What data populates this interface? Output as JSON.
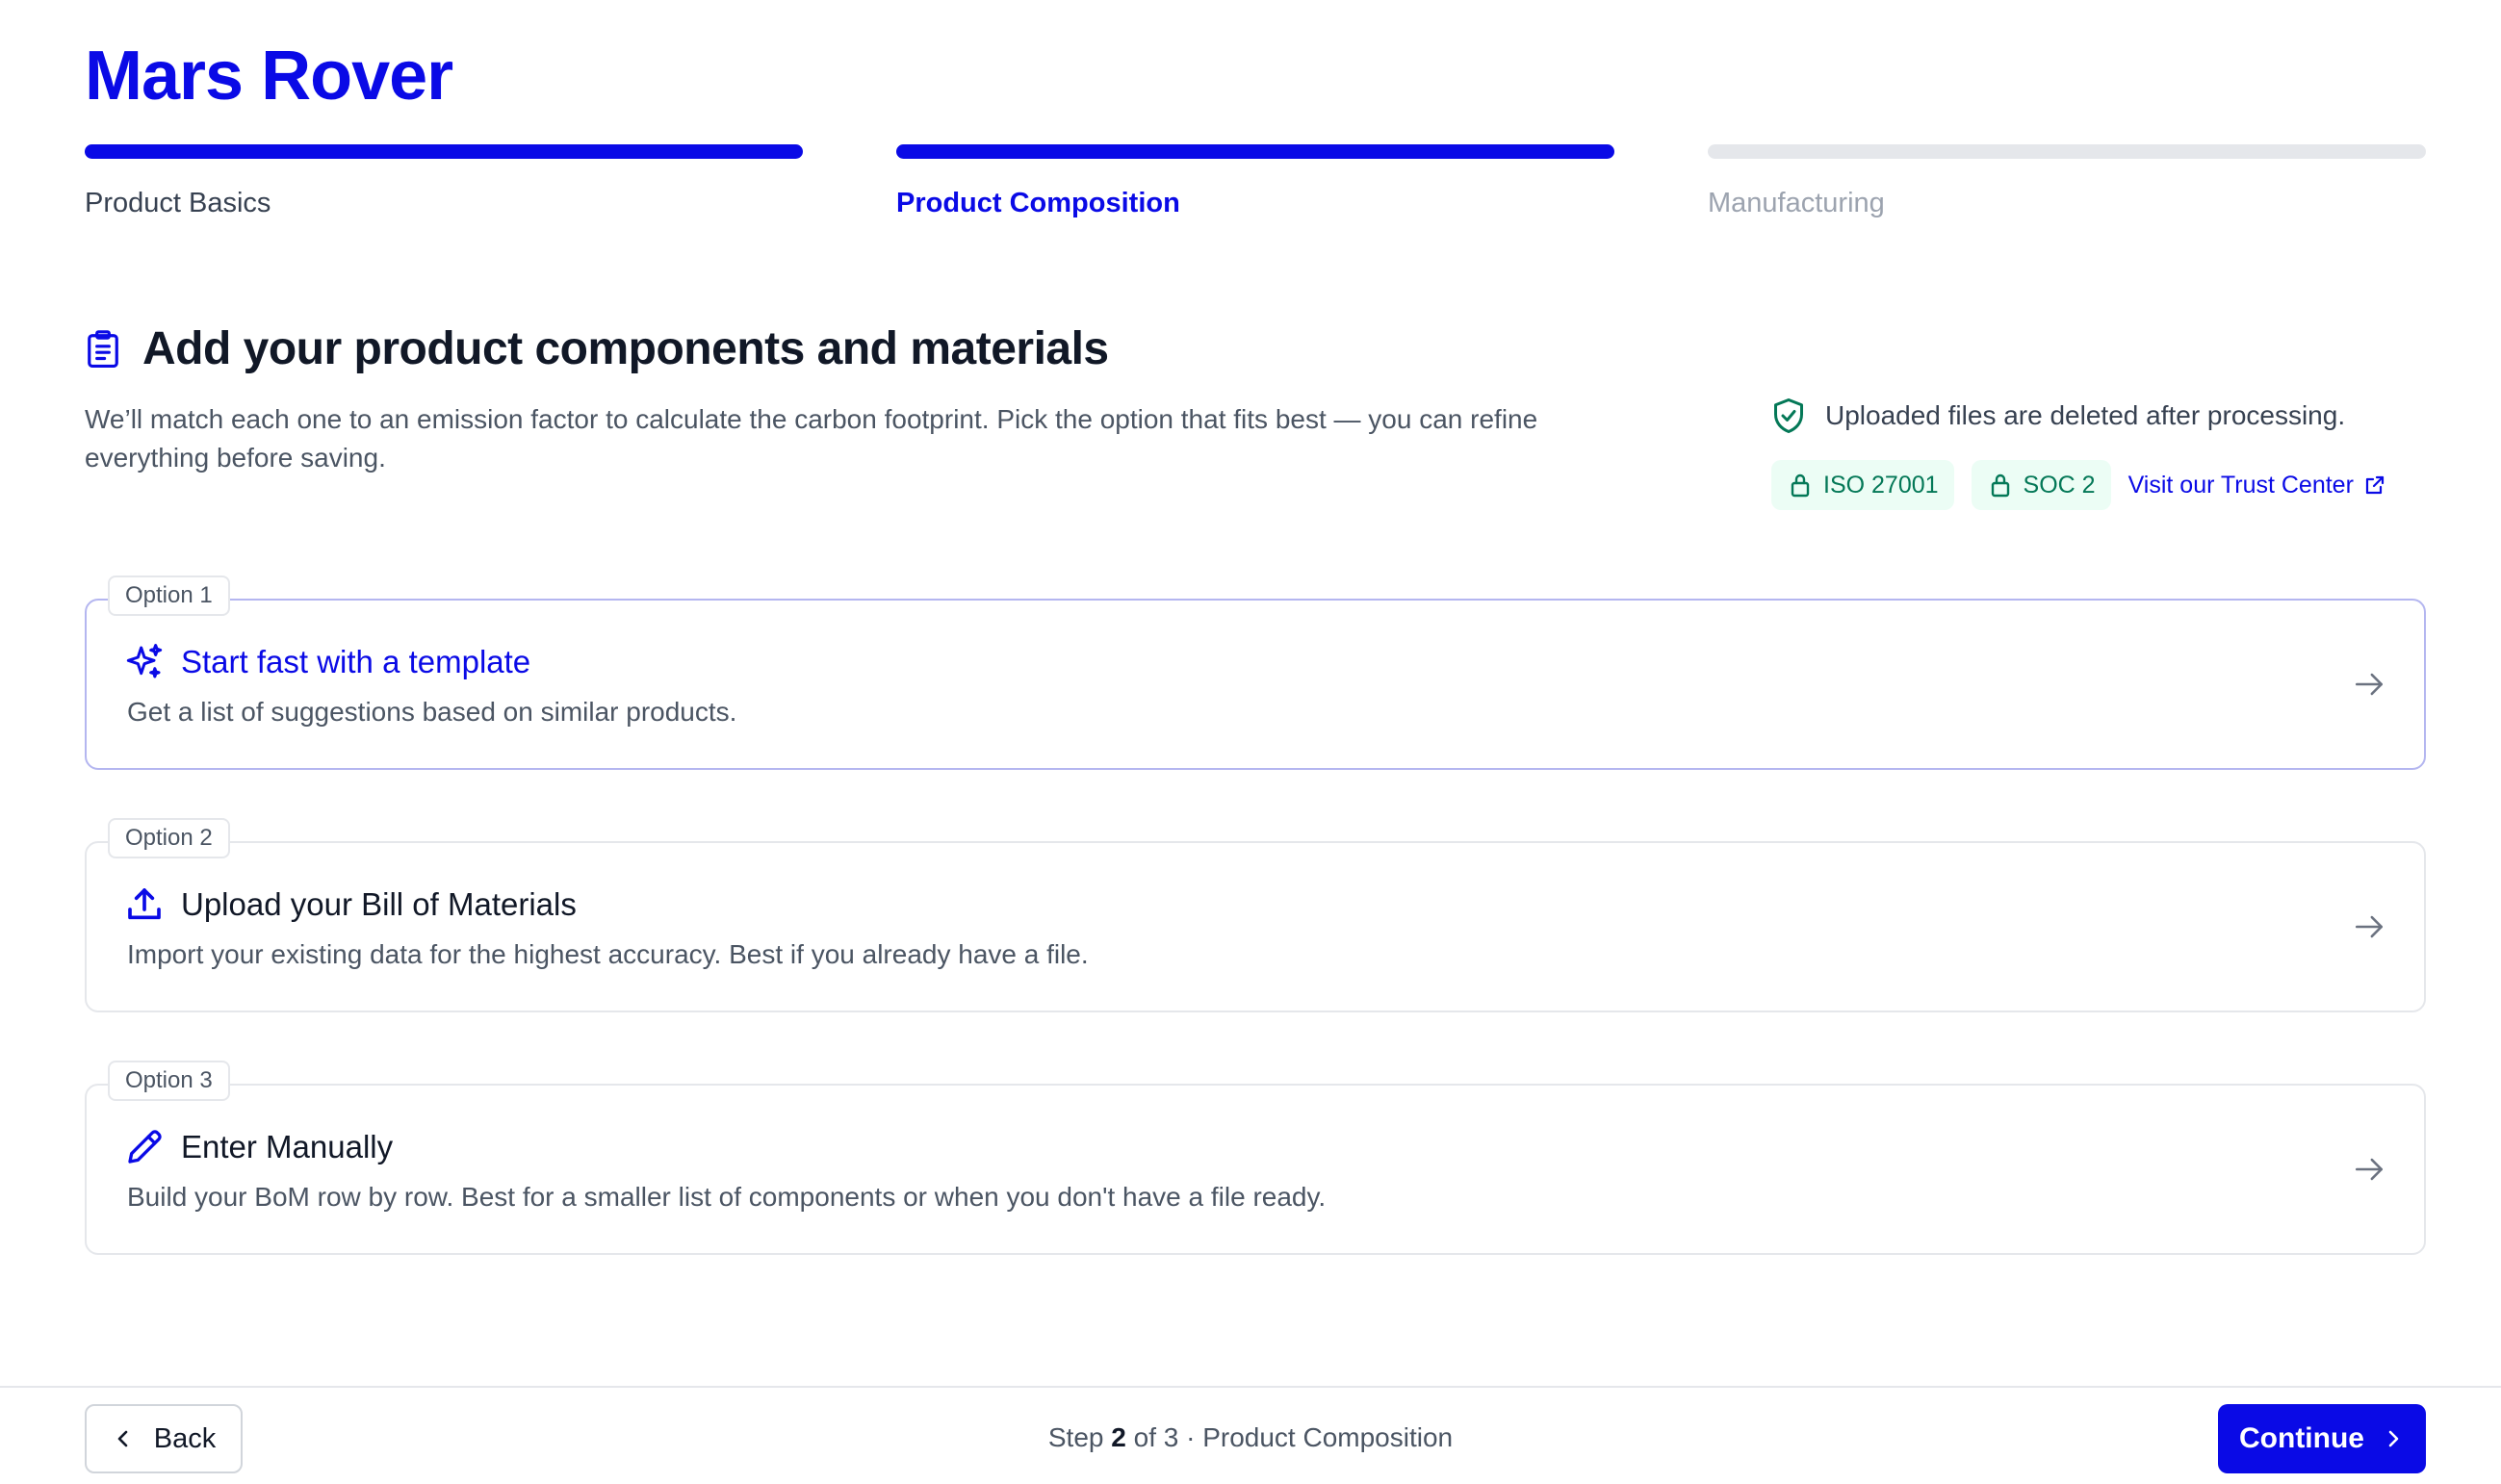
{
  "page": {
    "title": "Mars Rover"
  },
  "steps": [
    {
      "label": "Product Basics",
      "state": "done"
    },
    {
      "label": "Product Composition",
      "state": "active"
    },
    {
      "label": "Manufacturing",
      "state": "todo"
    }
  ],
  "section": {
    "icon": "clipboard-icon",
    "title": "Add your product components and materials",
    "subtitle": "We’ll match each one to an emission factor to calculate the carbon footprint. Pick the option that fits best — you can refine everything before saving."
  },
  "security": {
    "icon": "shield-check-icon",
    "note": "Uploaded files are deleted after processing.",
    "badges": [
      {
        "label": "ISO 27001",
        "icon": "lock-icon"
      },
      {
        "label": "SOC 2",
        "icon": "lock-icon"
      }
    ],
    "trust_link": "Visit our Trust Center",
    "trust_link_icon": "external-link-icon"
  },
  "options": [
    {
      "tag": "Option 1",
      "icon": "sparkles-icon",
      "title": "Start fast with a template",
      "description": "Get a list of suggestions based on similar products.",
      "selected": true
    },
    {
      "tag": "Option 2",
      "icon": "upload-icon",
      "title": "Upload your Bill of Materials",
      "description": "Import your existing data for the highest accuracy. Best if you already have a file.",
      "selected": false
    },
    {
      "tag": "Option 3",
      "icon": "pencil-icon",
      "title": "Enter Manually",
      "description": "Build your BoM row by row. Best for a smaller list of components or when you don't have a file ready.",
      "selected": false
    }
  ],
  "footer": {
    "back_label": "Back",
    "status_prefix": "Step",
    "current_step": "2",
    "status_of": "of 3 · Product Composition",
    "continue_label": "Continue"
  },
  "colors": {
    "accent": "#0a0ae6",
    "success": "#047857",
    "border": "#e5e7eb"
  }
}
